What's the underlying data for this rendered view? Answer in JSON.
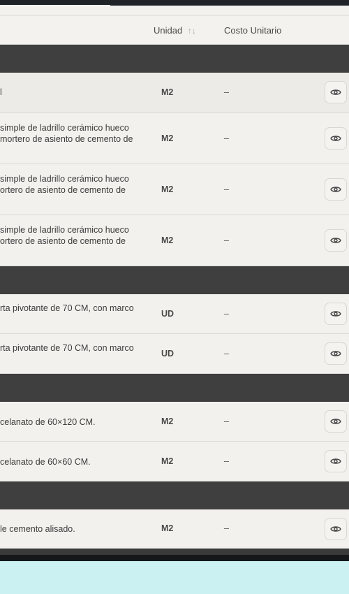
{
  "table": {
    "headers": {
      "unit": "Unidad",
      "unit_sort_icon": "↑↓",
      "cost": "Costo Unitario"
    },
    "rows": [
      {
        "desc": "l",
        "unit": "M2",
        "cost": "–"
      },
      {
        "desc": "simple de ladrillo cerámico hueco\nmortero de asiento de cemento de",
        "unit": "M2",
        "cost": "–"
      },
      {
        "desc": "simple de ladrillo cerámico hueco\nortero de asiento de cemento de",
        "unit": "M2",
        "cost": "–"
      },
      {
        "desc": "simple de ladrillo cerámico hueco\nortero de asiento de cemento de",
        "unit": "M2",
        "cost": "–"
      },
      {
        "desc": "rta pivotante de 70 CM, con marco",
        "unit": "UD",
        "cost": "–"
      },
      {
        "desc": "rta pivotante de 70 CM, con marco",
        "unit": "UD",
        "cost": "–"
      },
      {
        "desc": "celanato de 60×120 CM.",
        "unit": "M2",
        "cost": "–"
      },
      {
        "desc": "celanato de 60×60 CM.",
        "unit": "M2",
        "cost": "–"
      },
      {
        "desc": "le cemento alisado.",
        "unit": "M2",
        "cost": "–"
      }
    ],
    "row_action_icon": "eye-icon"
  },
  "colors": {
    "section_band": "#3f3f3f",
    "row_bg": "#f2f1ee",
    "page_bg": "#ccf1f3"
  }
}
